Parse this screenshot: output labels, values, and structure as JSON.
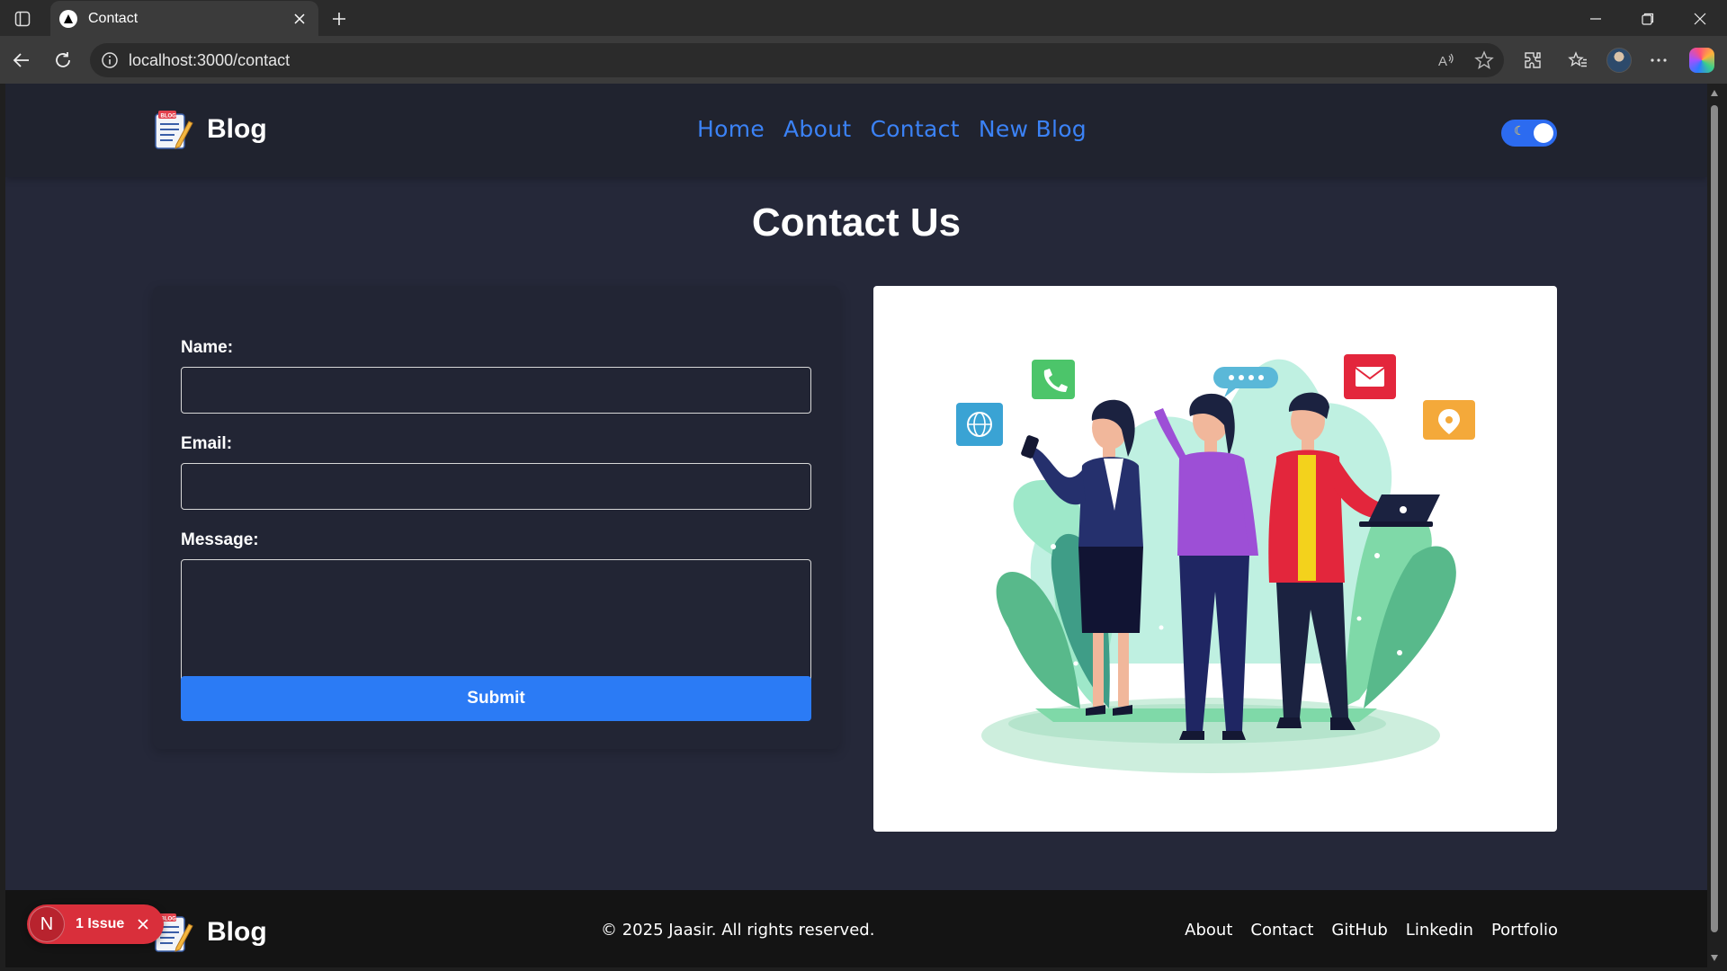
{
  "browser": {
    "tab_title": "Contact",
    "url": "localhost:3000/contact"
  },
  "site": {
    "logo_text": "Blog",
    "nav": [
      "Home",
      "About",
      "Contact",
      "New Blog"
    ],
    "toggle_icon": "moon-icon"
  },
  "page": {
    "title": "Contact Us",
    "form": {
      "name_label": "Name:",
      "name_value": "",
      "email_label": "Email:",
      "email_value": "",
      "message_label": "Message:",
      "message_value": "",
      "submit_label": "Submit"
    }
  },
  "footer": {
    "logo_text": "Blog",
    "copyright": "© 2025 Jaasir. All rights reserved.",
    "links": [
      "About",
      "Contact",
      "GitHub",
      "Linkedin",
      "Portfolio"
    ]
  },
  "dev_badge": {
    "logo": "N",
    "text": "1 Issue"
  },
  "colors": {
    "page_bg": "#252839",
    "header_bg": "#20232f",
    "accent": "#2b7bf5",
    "link": "#3b82f6",
    "footer_bg": "#141414",
    "issue_badge": "#d92f3b"
  }
}
